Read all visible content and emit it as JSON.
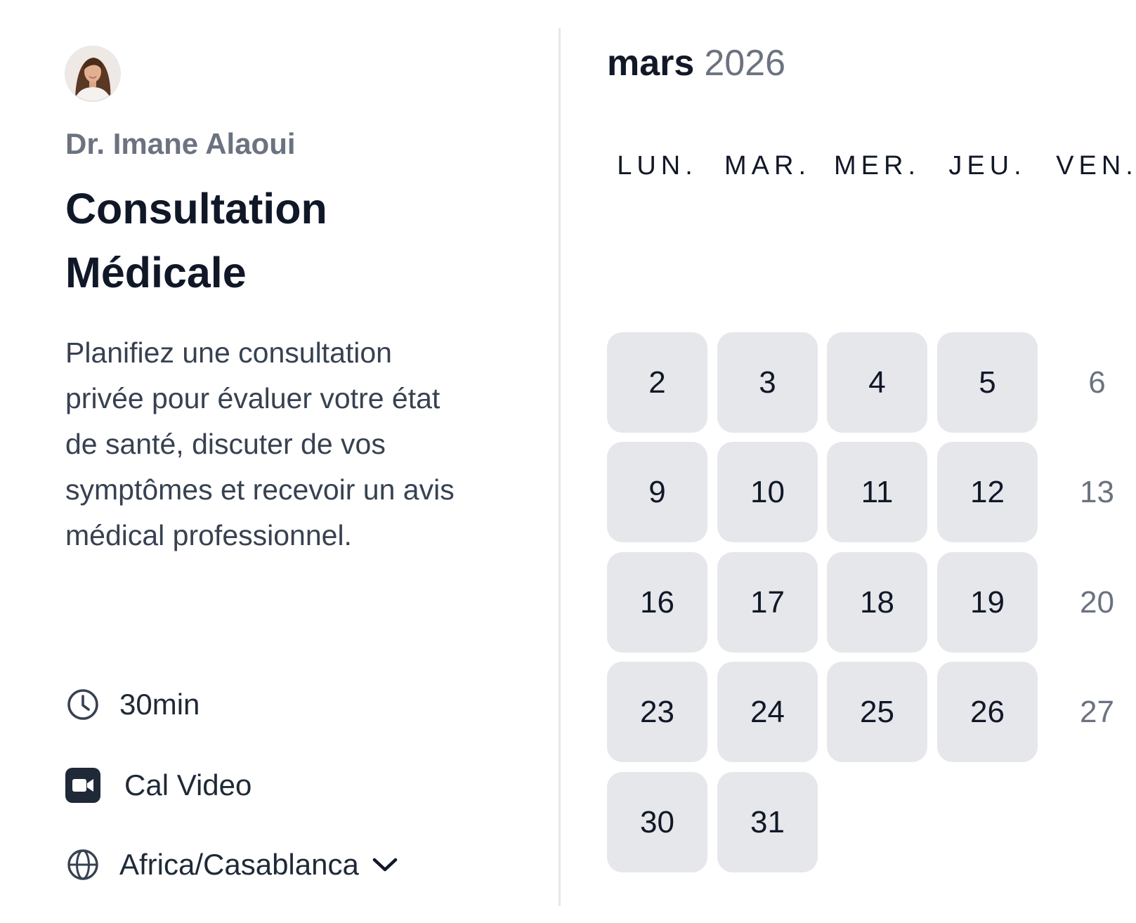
{
  "host": {
    "name": "Dr. Imane Alaoui",
    "avatar_icon": "doctor-portrait-avatar"
  },
  "event": {
    "title_line1": "Consultation",
    "title_line2": "Médicale",
    "description": "Planifiez une consultation privée pour évaluer votre état de santé, discuter de vos symptômes et recevoir un avis médical professionnel.",
    "duration": "30min",
    "location": "Cal Video",
    "timezone": "Africa/Casablanca"
  },
  "calendar": {
    "month": "mars",
    "year": "2026",
    "weekdays": [
      "LUN.",
      "MAR.",
      "MER.",
      "JEU.",
      "VEN."
    ],
    "weeks": [
      [
        {
          "d": "2",
          "available": true
        },
        {
          "d": "3",
          "available": true
        },
        {
          "d": "4",
          "available": true
        },
        {
          "d": "5",
          "available": true
        },
        {
          "d": "6",
          "available": false
        }
      ],
      [
        {
          "d": "9",
          "available": true
        },
        {
          "d": "10",
          "available": true
        },
        {
          "d": "11",
          "available": true
        },
        {
          "d": "12",
          "available": true
        },
        {
          "d": "13",
          "available": false
        }
      ],
      [
        {
          "d": "16",
          "available": true
        },
        {
          "d": "17",
          "available": true
        },
        {
          "d": "18",
          "available": true
        },
        {
          "d": "19",
          "available": true
        },
        {
          "d": "20",
          "available": false
        }
      ],
      [
        {
          "d": "23",
          "available": true
        },
        {
          "d": "24",
          "available": true
        },
        {
          "d": "25",
          "available": true
        },
        {
          "d": "26",
          "available": true
        },
        {
          "d": "27",
          "available": false
        }
      ],
      [
        {
          "d": "30",
          "available": true
        },
        {
          "d": "31",
          "available": true
        }
      ]
    ]
  },
  "colors": {
    "available_bg": "#e5e7eb",
    "muted_text": "#6b7280",
    "heading_text": "#101828"
  },
  "icons": {
    "duration": "clock-icon",
    "location": "video-camera-icon",
    "timezone": "globe-icon",
    "timezone_toggle": "chevron-down-icon"
  }
}
